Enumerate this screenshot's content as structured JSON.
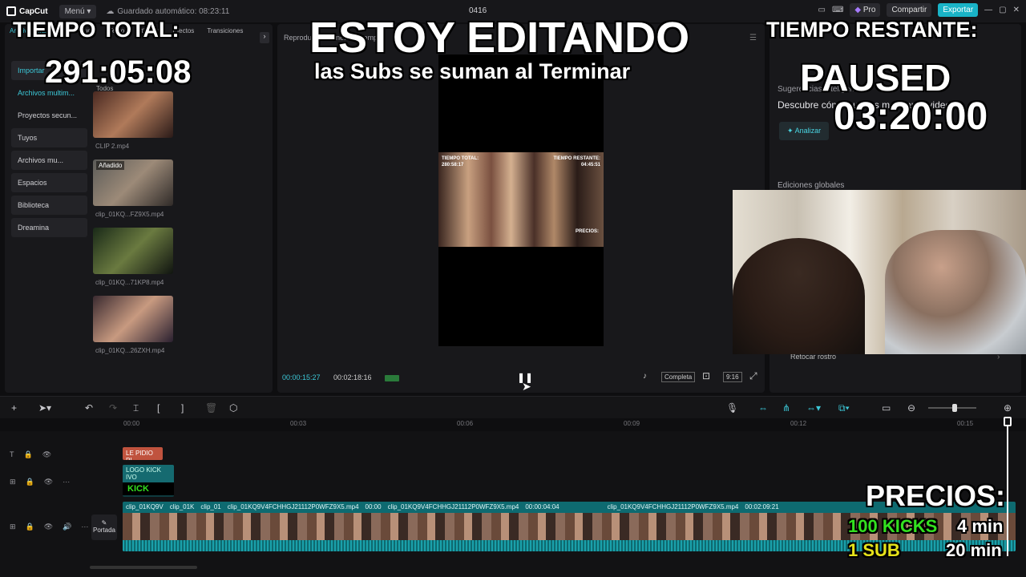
{
  "app": {
    "name": "CapCut",
    "menu_label": "Menú",
    "autosave": "Guardado automático: 08:23:11",
    "project_title": "0416",
    "pro_label": "Pro",
    "share_label": "Compartir",
    "export_label": "Exportar",
    "accent_color": "#19b3c7"
  },
  "left_panel": {
    "tabs": [
      "Archivos multimedia",
      "Audio",
      "Texto",
      "Stickers",
      "Efectos",
      "Transiciones"
    ],
    "side_items": [
      {
        "label": "Importar"
      },
      {
        "label": "Archivos multim..."
      },
      {
        "label": "Proyectos secun..."
      },
      {
        "label": "Tuyos"
      },
      {
        "label": "Archivos mu..."
      },
      {
        "label": "Espacios"
      },
      {
        "label": "Biblioteca"
      },
      {
        "label": "Dreamina"
      }
    ],
    "filter_label": "Todos",
    "media": [
      {
        "name": "CLIP 2.mp4",
        "badge": ""
      },
      {
        "name": "clip_01KQ...FZ9X5.mp4",
        "badge": "Añadido"
      },
      {
        "name": "clip_01KQ...71KP8.mp4",
        "badge": ""
      },
      {
        "name": "clip_01KQ...26ZXH.mp4",
        "badge": ""
      }
    ]
  },
  "viewer": {
    "header": "Reproductor - Línea de tiempo",
    "current_time": "00:00:15:27",
    "total_time": "00:02:18:16",
    "quality_label": "Completa",
    "ratio_label": "9:16"
  },
  "right_panel": {
    "suggestions_title": "Sugerencias inteligentes",
    "suggestions_text": "Descubre cómo puedes mejorar tu video",
    "analyze_label": "Analizar",
    "global_edits": "Ediciones globales",
    "retouch_label": "Retocar rostro"
  },
  "ruler_ticks": [
    "00:00",
    "00:03",
    "00:06",
    "00:09",
    "00:12",
    "00:15"
  ],
  "tracks": {
    "text_clip": "LE PIDIO PL",
    "logo_clip": "LOGO KICK IVO",
    "kick_label": "KICK",
    "cover_label": "Portada",
    "main_clips": [
      "clip_01KQ9V",
      "clip_01K",
      "clip_01",
      "clip_01KQ9V4FCHHGJ21112P0WFZ9X5.mp4",
      "00:00",
      "clip_01KQ9V4FCHHGJ21112P0WFZ9X5.mp4",
      "00:00:04:04",
      "clip_01KQ9V4FCHHGJ21112P0WFZ9X5.mp4",
      "00:02:09:21"
    ]
  },
  "stream_overlay": {
    "total_label": "TIEMPO TOTAL:",
    "total_value": "291:05:08",
    "headline": "ESTOY EDITANDO",
    "subheadline": "las Subs se suman al Terminar",
    "remaining_label": "TIEMPO RESTANTE:",
    "status": "PAUSED",
    "remaining_value": "03:20:00",
    "prices_title": "PRECIOS:",
    "price_1_item": "100 KICKS",
    "price_1_value": "4 min",
    "price_2_item": "1 SUB",
    "price_2_value": "20 min",
    "kicks_color": "#33e11f",
    "sub_color": "#e6e21a"
  },
  "inner_video": {
    "left_label": "TIEMPO TOTAL:",
    "left_value": "280:58:17",
    "right_label": "TIEMPO RESTANTE:",
    "right_value": "04:45:51",
    "prices_label": "PRECIOS:"
  }
}
